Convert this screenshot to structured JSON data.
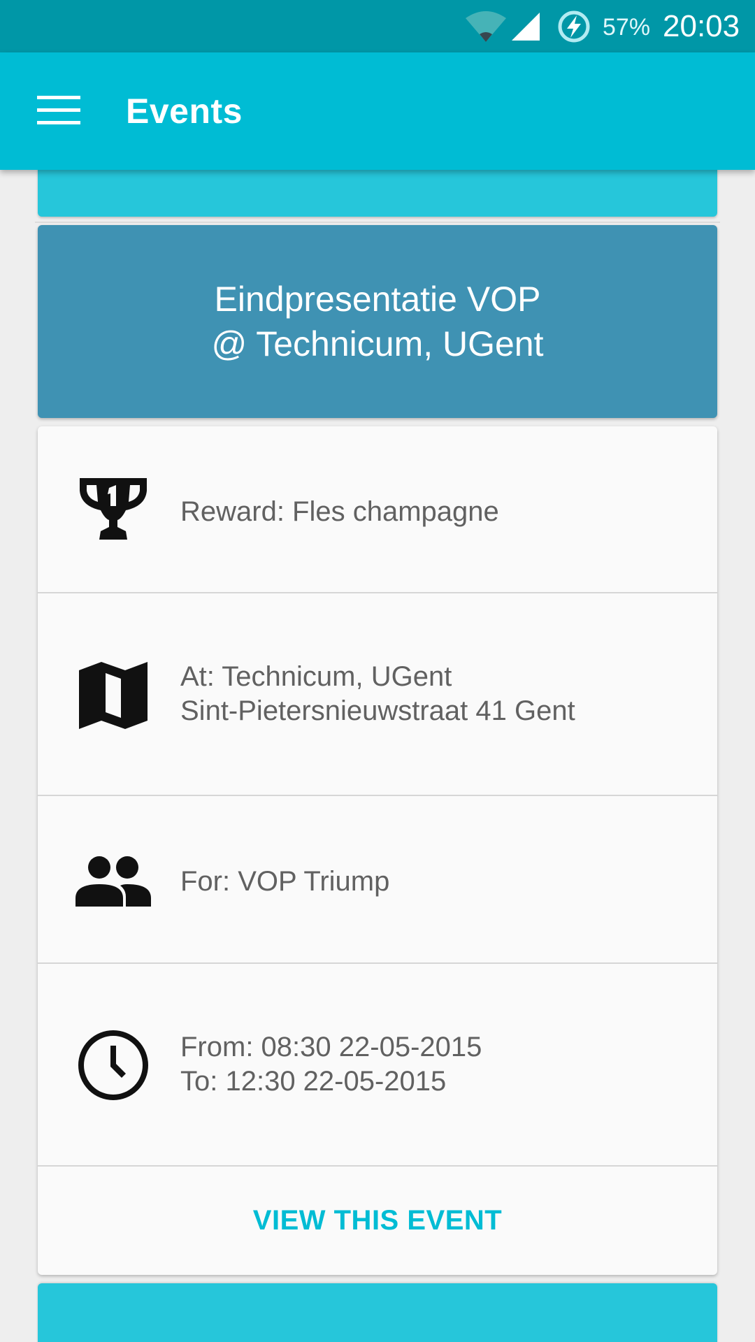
{
  "status_bar": {
    "battery_percent": "57%",
    "time": "20:03",
    "icons": [
      "wifi-icon",
      "signal-icon",
      "battery-charging-icon"
    ]
  },
  "toolbar": {
    "title": "Events",
    "menu_icon": "hamburger-menu-icon"
  },
  "event": {
    "title_line1": "Eindpresentatie VOP",
    "title_line2": "@ Technicum, UGent",
    "reward": {
      "icon": "trophy-icon",
      "text": "Reward: Fles champagne"
    },
    "location": {
      "icon": "map-icon",
      "line1": "At: Technicum, UGent",
      "line2": "Sint-Pietersnieuwstraat 41 Gent"
    },
    "audience": {
      "icon": "group-icon",
      "text": "For: VOP Triump"
    },
    "time": {
      "icon": "clock-icon",
      "line1": "From: 08:30 22-05-2015",
      "line2": "To: 12:30 22-05-2015"
    },
    "action_label": "VIEW THIS EVENT"
  },
  "colors": {
    "status_bar": "#0097a7",
    "toolbar": "#00bcd4",
    "event_header": "#3f92b3",
    "accent": "#00bcd4",
    "card_peek": "#26c6da"
  }
}
